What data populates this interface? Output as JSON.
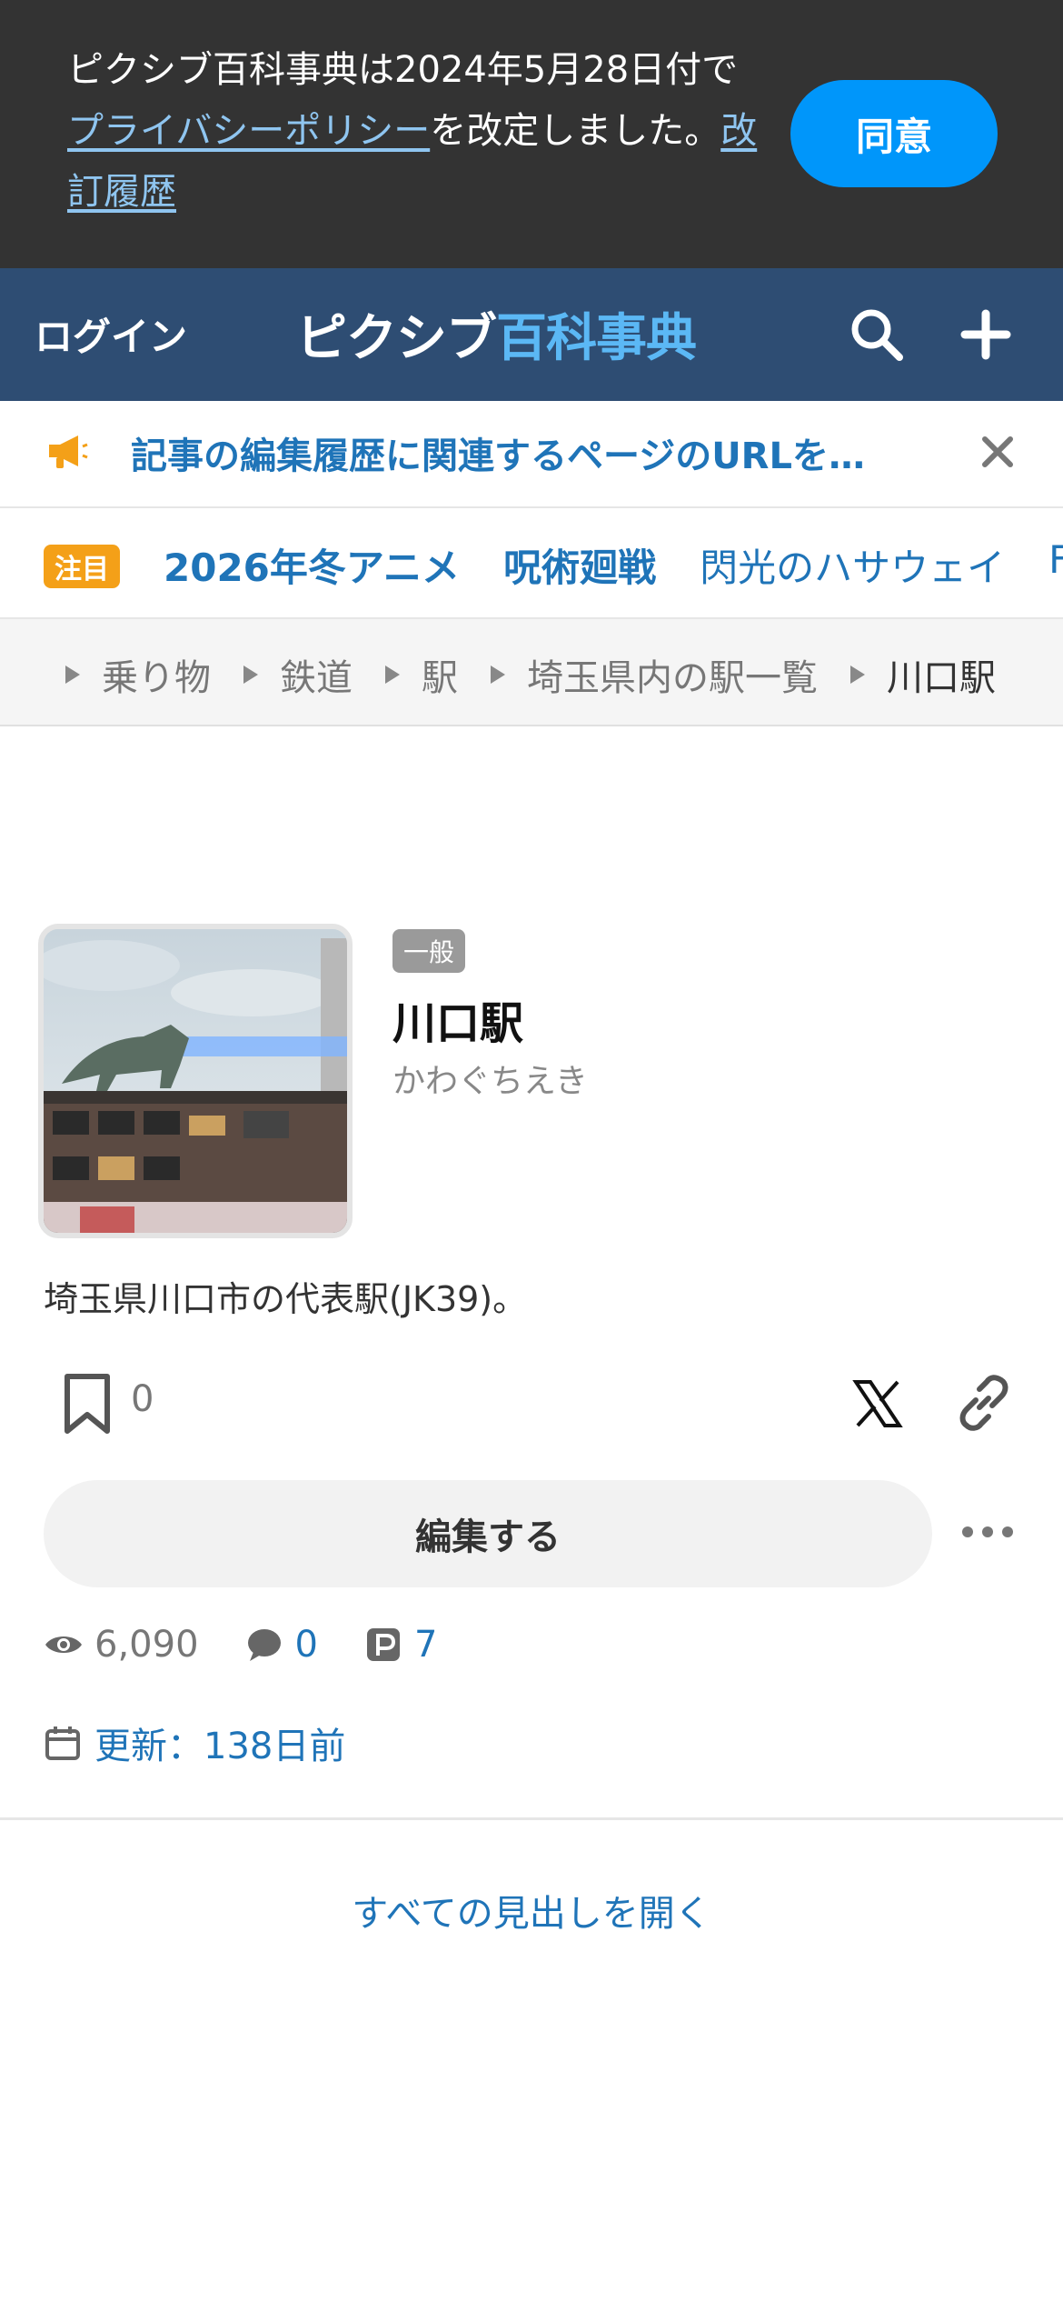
{
  "consent": {
    "text_part1": "ピクシブ百科事典は2024年5月28日付で",
    "privacy_link": "プライバシーポリシー",
    "text_part2": "を改定しました。",
    "history_link": "改訂履歴",
    "agree_label": "同意"
  },
  "header": {
    "login_label": "ログイン",
    "logo_part1": "ピクシブ",
    "logo_part2": "百科事典",
    "search_icon": "search-icon",
    "plus_icon": "plus-icon"
  },
  "notice": {
    "text": "記事の編集履歴に関連するページのURLを…"
  },
  "trending": {
    "badge": "注目",
    "items": [
      "2026年冬アニメ",
      "呪術廻戦",
      "閃光のハサウェイ",
      "F"
    ]
  },
  "breadcrumb": [
    "乗り物",
    "鉄道",
    "駅",
    "埼玉県内の駅一覧",
    "川口駅"
  ],
  "article": {
    "genre": "一般",
    "title": "川口駅",
    "reading": "かわぐちえき",
    "summary": "埼玉県川口市の代表駅(JK39)。",
    "bookmark_count": "0",
    "edit_label": "編集する",
    "stats": {
      "views": "6,090",
      "comments": "0",
      "pixiv_works": "7"
    },
    "updated": "更新：138日前"
  },
  "open_all_label": "すべての見出しを開く",
  "colors": {
    "header_bg": "#2e4d73",
    "accent_blue": "#0096fa",
    "link_blue": "#1f74b8",
    "badge_orange": "#f4a018"
  }
}
